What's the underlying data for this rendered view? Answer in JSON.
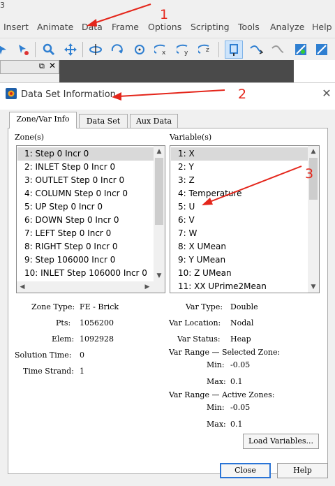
{
  "app": {
    "title_fragment": "3"
  },
  "menubar": {
    "items": [
      "Insert",
      "Animate",
      "Data",
      "Frame",
      "Options",
      "Scripting",
      "Tools",
      "Analyze",
      "Help"
    ]
  },
  "dialog": {
    "title": "Data Set Information",
    "close_glyph": "✕",
    "tabs": [
      "Zone/Var Info",
      "Data Set",
      "Aux Data"
    ],
    "zones": {
      "label": "Zone(s)",
      "items": [
        "1: Step 0 Incr 0",
        "2: INLET Step 0 Incr 0",
        "3: OUTLET Step 0 Incr 0",
        "4: COLUMN Step 0 Incr 0",
        "5: UP Step 0 Incr 0",
        "6: DOWN Step 0 Incr 0",
        "7: LEFT Step 0 Incr 0",
        "8: RIGHT Step 0 Incr 0",
        "9: Step 106000 Incr 0",
        "10: INLET Step 106000 Incr 0"
      ],
      "selected_index": 0
    },
    "variables": {
      "label": "Variable(s)",
      "items": [
        "1: X",
        "2: Y",
        "3: Z",
        "4: Temperature",
        "5: U",
        "6: V",
        "7: W",
        "8: X UMean",
        "9: Y UMean",
        "10: Z UMean",
        "11: XX UPrime2Mean"
      ],
      "selected_index": 0
    },
    "zone_info": {
      "zone_type_label": "Zone Type:",
      "zone_type": "FE - Brick",
      "pts_label": "Pts:",
      "pts": "1056200",
      "elem_label": "Elem:",
      "elem": "1092928",
      "solution_time_label": "Solution Time:",
      "solution_time": "0",
      "time_strand_label": "Time Strand:",
      "time_strand": "1"
    },
    "var_info": {
      "var_type_label": "Var Type:",
      "var_type": "Double",
      "var_location_label": "Var Location:",
      "var_location": "Nodal",
      "var_status_label": "Var Status:",
      "var_status": "Heap",
      "range_selected_label": "Var Range — Selected Zone:",
      "range_active_label": "Var Range — Active Zones:",
      "min_label": "Min:",
      "max_label": "Max:",
      "selected_min": "-0.05",
      "selected_max": "0.1",
      "active_min": "-0.05",
      "active_max": "0.1"
    },
    "buttons": {
      "load_variables": "Load Variables...",
      "close": "Close",
      "help": "Help"
    }
  },
  "annotations": {
    "marker_1": "1",
    "marker_2": "2",
    "marker_3": "3",
    "color": "#e4261b"
  }
}
